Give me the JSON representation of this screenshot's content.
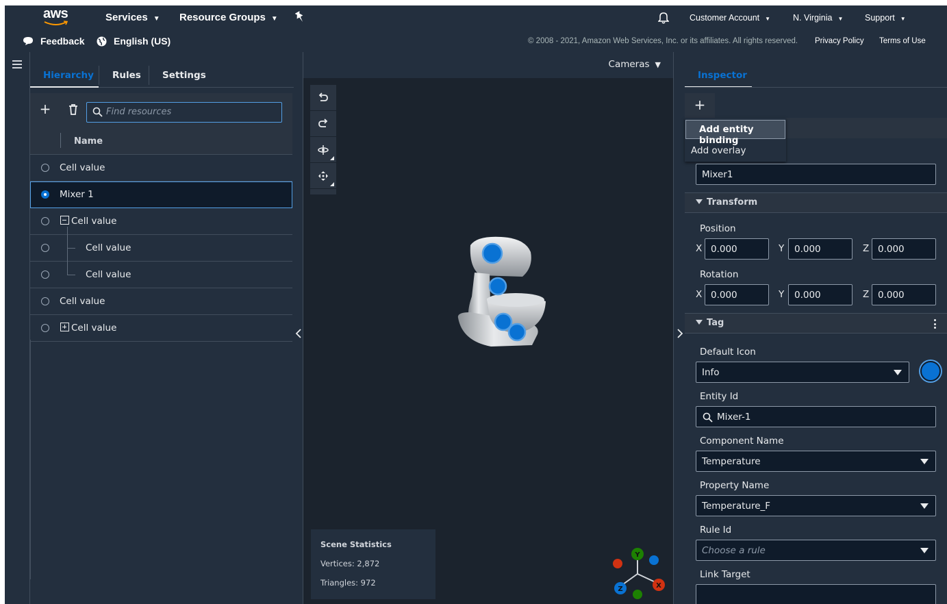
{
  "topnav": {
    "logo": "aws",
    "services": "Services",
    "resource_groups": "Resource Groups",
    "account": "Customer Account",
    "region": "N. Virginia",
    "support": "Support"
  },
  "subnav": {
    "feedback": "Feedback",
    "language": "English (US)",
    "copyright": "© 2008 - 2021, Amazon Web Services, Inc. or its affiliates. All rights reserved.",
    "privacy": "Privacy Policy",
    "terms": "Terms of Use"
  },
  "left_panel": {
    "tabs": [
      "Hierarchy",
      "Rules",
      "Settings"
    ],
    "search_placeholder": "Find resources",
    "column_name": "Name",
    "rows": [
      {
        "label": "Cell value",
        "selected": false,
        "indent": 0,
        "expander": "none"
      },
      {
        "label": "Mixer 1",
        "selected": true,
        "indent": 0,
        "expander": "none"
      },
      {
        "label": "Cell value",
        "selected": false,
        "indent": 0,
        "expander": "collapse"
      },
      {
        "label": "Cell value",
        "selected": false,
        "indent": 1,
        "expander": "none"
      },
      {
        "label": "Cell value",
        "selected": false,
        "indent": 1,
        "expander": "none"
      },
      {
        "label": "Cell value",
        "selected": false,
        "indent": 0,
        "expander": "none"
      },
      {
        "label": "Cell value",
        "selected": false,
        "indent": 0,
        "expander": "expand"
      }
    ]
  },
  "viewport": {
    "cameras": "Cameras",
    "stats_title": "Scene Statistics",
    "vertices": "Vertices: 2,872",
    "triangles": "Triangles: 972",
    "gizmo": {
      "y": "Y",
      "x": "X",
      "z": "Z"
    }
  },
  "inspector": {
    "tab": "Inspector",
    "menu_add_entity": "Add entity binding",
    "menu_add_overlay": "Add overlay",
    "name_value": "Mixer1",
    "transform_title": "Transform",
    "position_label": "Position",
    "rotation_label": "Rotation",
    "position": {
      "x": "0.000",
      "y": "0.000",
      "z": "0.000"
    },
    "rotation": {
      "x": "0.000",
      "y": "0.000",
      "z": "0.000"
    },
    "axis_labels": {
      "x": "X",
      "y": "Y",
      "z": "Z"
    },
    "tag_title": "Tag",
    "default_icon_label": "Default Icon",
    "default_icon_value": "Info",
    "entity_id_label": "Entity Id",
    "entity_id_value": "Mixer-1",
    "component_name_label": "Component Name",
    "component_name_value": "Temperature",
    "property_name_label": "Property Name",
    "property_name_value": "Temperature_F",
    "rule_id_label": "Rule Id",
    "rule_id_placeholder": "Choose a rule",
    "link_target_label": "Link Target",
    "link_target_value": ""
  },
  "colors": {
    "background": "#232f3e",
    "viewport": "#1b232d",
    "accent": "#0972d3",
    "gizmo_x": "#d13212",
    "gizmo_y": "#1d8102",
    "gizmo_z": "#0972d3"
  }
}
